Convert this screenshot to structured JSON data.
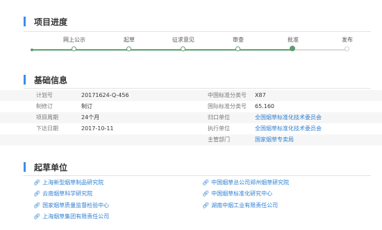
{
  "progress": {
    "title": "项目进度",
    "steps": [
      {
        "label": "网上公示"
      },
      {
        "label": "起草"
      },
      {
        "label": "征求意见"
      },
      {
        "label": "审查"
      },
      {
        "label": "批准"
      },
      {
        "label": "发布"
      }
    ],
    "current_step": "批准"
  },
  "basic": {
    "title": "基础信息",
    "left": [
      {
        "label": "计划号",
        "value": "20171624-Q-456"
      },
      {
        "label": "制修订",
        "value": "制订"
      },
      {
        "label": "项目周期",
        "value": "24个月"
      },
      {
        "label": "下达日期",
        "value": "2017-10-11"
      }
    ],
    "right": [
      {
        "label": "中国标准分类号",
        "value": "X87"
      },
      {
        "label": "国际标准分类号",
        "value": "65.160"
      },
      {
        "label": "归口单位",
        "value": "全国烟草标准化技术委员会"
      },
      {
        "label": "执行单位",
        "value": "全国烟草标准化技术委员会"
      },
      {
        "label": "主管部门",
        "value": "国家烟草专卖局"
      }
    ]
  },
  "drafting": {
    "title": "起草单位",
    "units": [
      {
        "name": "上海新型烟草制品研究院"
      },
      {
        "name": "中国烟草总公司郑州烟草研究院"
      },
      {
        "name": "云南烟草科学研究院"
      },
      {
        "name": "中国烟草标准化研究中心"
      },
      {
        "name": "国家烟草质量监督检验中心"
      },
      {
        "name": "湖南中烟工业有限责任公司"
      },
      {
        "name": "上海烟草集团有限责任公司"
      }
    ]
  },
  "colors": {
    "accent_bar": "#3a8ee6",
    "progress_done": "#5c9e6e",
    "link": "#2b7ed1"
  }
}
